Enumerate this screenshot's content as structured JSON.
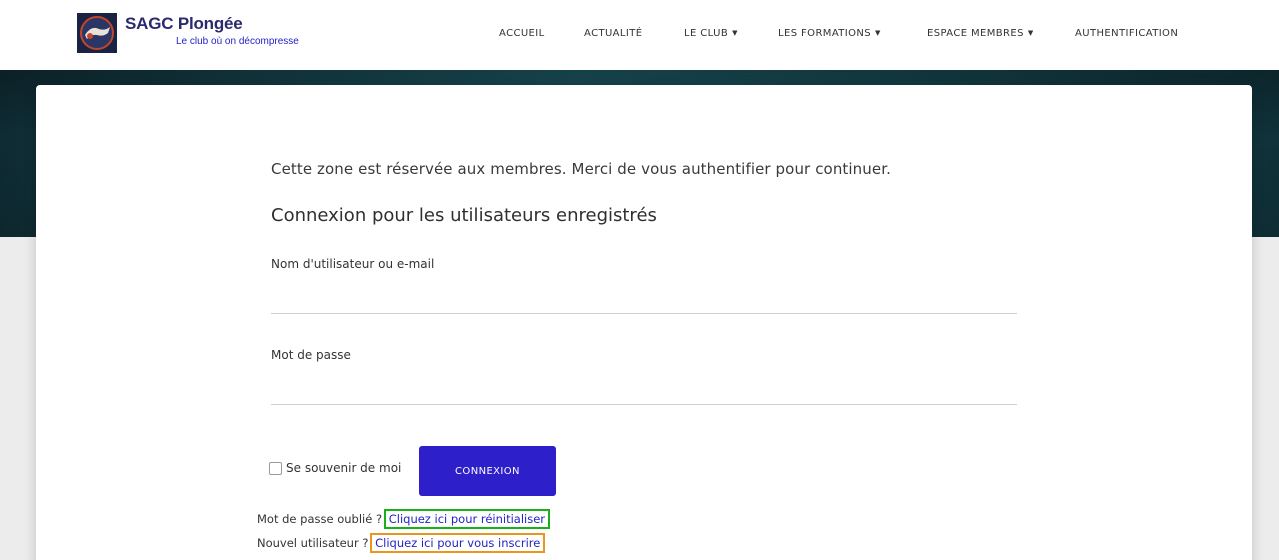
{
  "brand": {
    "title": "SAGC Plongée",
    "subtitle": "Le club où on décompresse",
    "logo_icon": "diver-club-logo"
  },
  "nav": {
    "items": [
      {
        "label": "ACCUEIL"
      },
      {
        "label": "ACTUALITÉ"
      },
      {
        "label": "LE CLUB",
        "dropdown": true
      },
      {
        "label": "LES FORMATIONS",
        "dropdown": true
      },
      {
        "label": "ESPACE MEMBRES",
        "dropdown": true
      },
      {
        "label": "AUTHENTIFICATION"
      }
    ],
    "caret": "▼"
  },
  "page": {
    "intro": "Cette zone est réservée aux membres. Merci de vous authentifier pour continuer.",
    "login_title": "Connexion pour les utilisateurs enregistrés"
  },
  "form": {
    "username_label": "Nom d'utilisateur ou e-mail",
    "username_value": "",
    "password_label": "Mot de passe",
    "password_value": "",
    "remember_label": "Se souvenir de moi",
    "remember_checked": false,
    "submit_label": "CONNEXION"
  },
  "help": {
    "forgot_prefix": "Mot de passe oublié ?",
    "forgot_link": "Cliquez ici pour réinitialiser",
    "new_user_prefix": "Nouvel utilisateur ?",
    "new_user_link": "Cliquez ici pour vous inscrire"
  },
  "colors": {
    "accent": "#2d1fc9",
    "link": "#2323c8",
    "highlight_reset": "#1ab01a",
    "highlight_register": "#e8961e"
  }
}
